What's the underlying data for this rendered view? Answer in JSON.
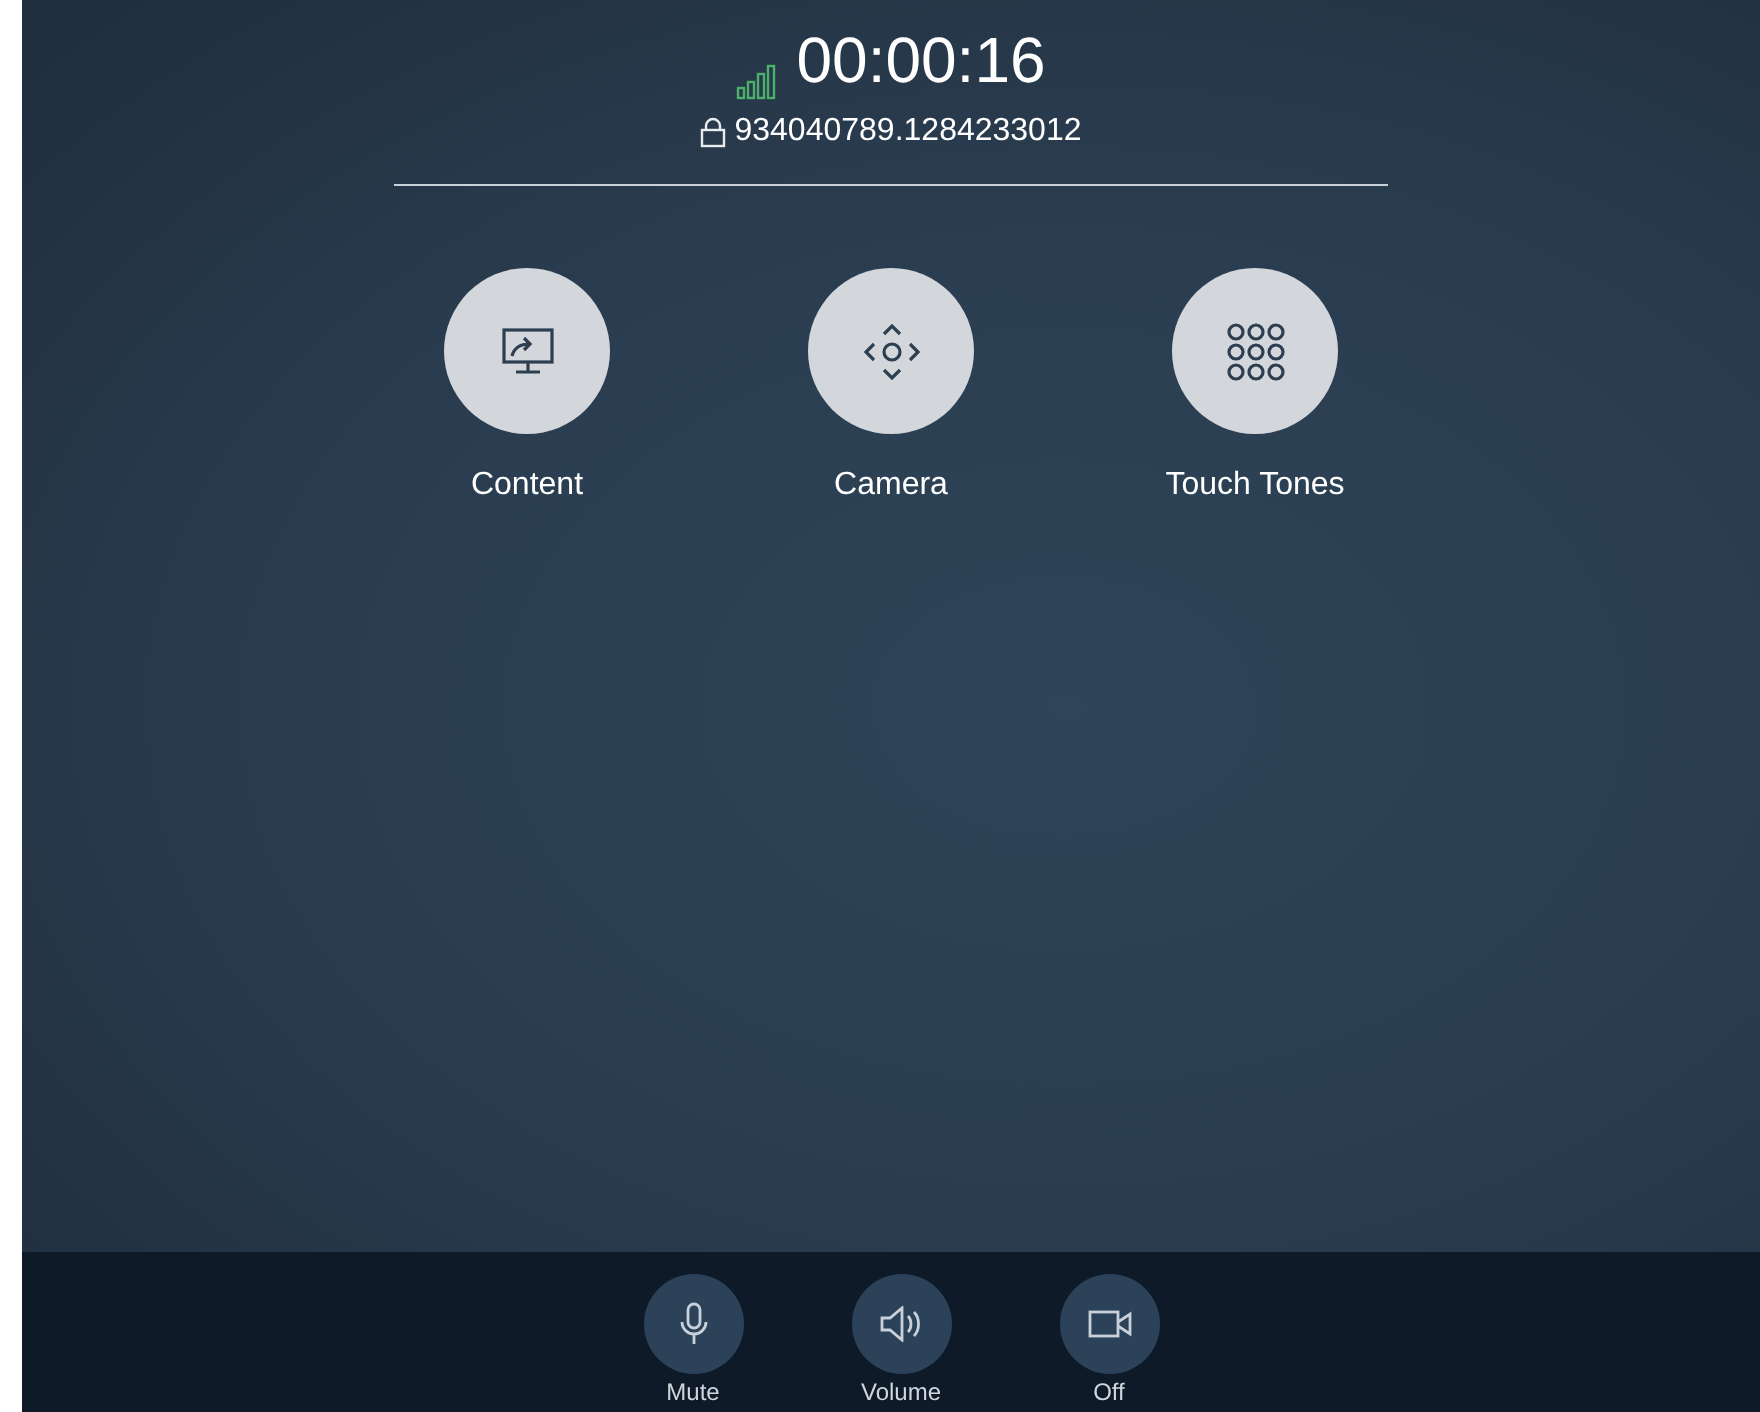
{
  "call": {
    "timer": "00:00:16",
    "meeting_id": "934040789.1284233012"
  },
  "actions": [
    {
      "kind": "content",
      "label": "Content"
    },
    {
      "kind": "camera",
      "label": "Camera"
    },
    {
      "kind": "keypad",
      "label": "Touch Tones"
    }
  ],
  "controls": [
    {
      "kind": "mic",
      "label": "Mute"
    },
    {
      "kind": "volume",
      "label": "Volume"
    },
    {
      "kind": "video",
      "label": "Off"
    }
  ]
}
